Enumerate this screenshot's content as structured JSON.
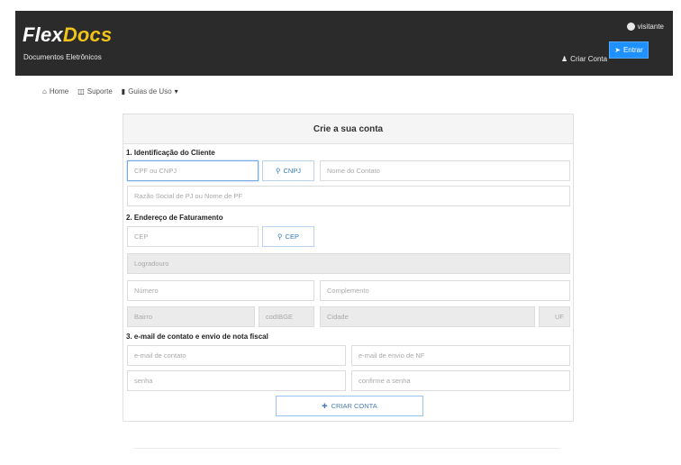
{
  "header": {
    "brand_part1": "Flex",
    "brand_part2": "Docs",
    "brand_sub": "Documentos Eletrônicos",
    "user_label": "visitante",
    "criar_conta": "Criar Conta",
    "entrar": "Entrar"
  },
  "nav": {
    "items": [
      {
        "label": "Home",
        "icon": "home-icon"
      },
      {
        "label": "Suporte",
        "icon": "support-icon"
      },
      {
        "label": "Guias de Uso",
        "icon": "book-icon"
      }
    ]
  },
  "form": {
    "title": "Crie a sua conta",
    "section1": "1. Identificação do Cliente",
    "section2": "2. Endereço de Faturamento",
    "section3": "3. e-mail de contato e envio de nota fiscal",
    "cpf_placeholder": "CPF ou CNPJ",
    "cpf_button": "CNPJ",
    "nome_contato": "Nome do Contato",
    "razao_social": "Razão Social de PJ ou Nome de PF",
    "cep": "CEP",
    "cep_button": "CEP",
    "logradouro": "Logradouro",
    "numero": "Número",
    "complemento": "Complemento",
    "bairro": "Bairro",
    "codibge": "codIBGE",
    "cidade": "Cidade",
    "uf": "UF",
    "email_contato": "e-mail de contato",
    "email_nf": "e-mail de envio de NF",
    "senha": "senha",
    "confirme_senha": "confirme a senha",
    "criar_conta_btn": "CRIAR CONTA"
  }
}
